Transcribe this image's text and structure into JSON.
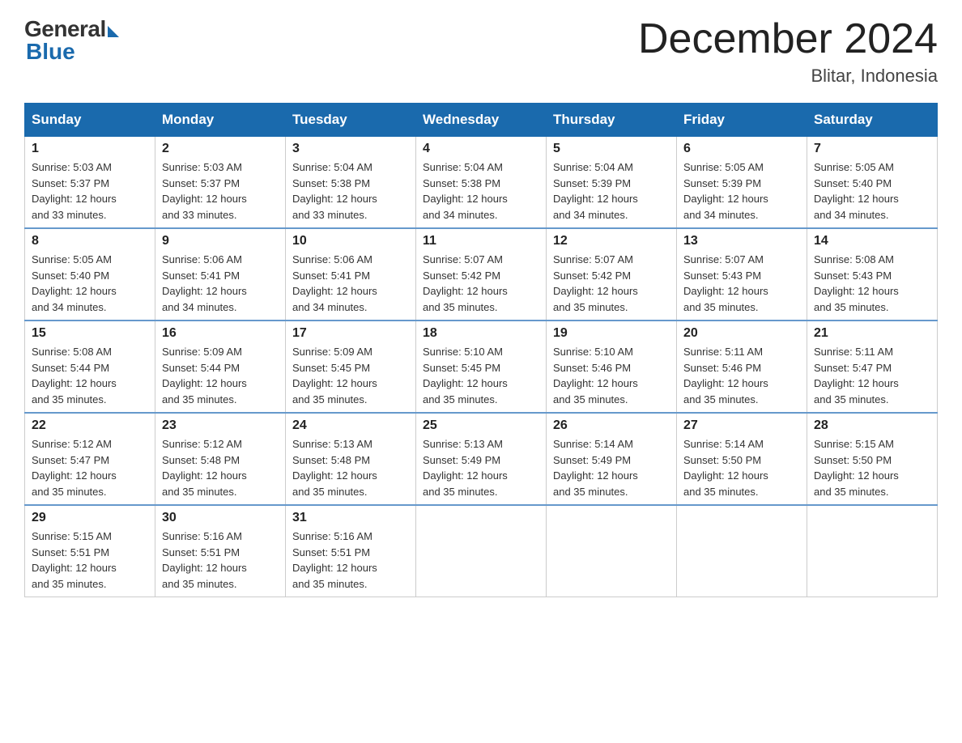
{
  "header": {
    "logo_general": "General",
    "logo_blue": "Blue",
    "title": "December 2024",
    "location": "Blitar, Indonesia"
  },
  "days_of_week": [
    "Sunday",
    "Monday",
    "Tuesday",
    "Wednesday",
    "Thursday",
    "Friday",
    "Saturday"
  ],
  "weeks": [
    [
      {
        "day": "1",
        "sunrise": "5:03 AM",
        "sunset": "5:37 PM",
        "daylight": "12 hours and 33 minutes."
      },
      {
        "day": "2",
        "sunrise": "5:03 AM",
        "sunset": "5:37 PM",
        "daylight": "12 hours and 33 minutes."
      },
      {
        "day": "3",
        "sunrise": "5:04 AM",
        "sunset": "5:38 PM",
        "daylight": "12 hours and 33 minutes."
      },
      {
        "day": "4",
        "sunrise": "5:04 AM",
        "sunset": "5:38 PM",
        "daylight": "12 hours and 34 minutes."
      },
      {
        "day": "5",
        "sunrise": "5:04 AM",
        "sunset": "5:39 PM",
        "daylight": "12 hours and 34 minutes."
      },
      {
        "day": "6",
        "sunrise": "5:05 AM",
        "sunset": "5:39 PM",
        "daylight": "12 hours and 34 minutes."
      },
      {
        "day": "7",
        "sunrise": "5:05 AM",
        "sunset": "5:40 PM",
        "daylight": "12 hours and 34 minutes."
      }
    ],
    [
      {
        "day": "8",
        "sunrise": "5:05 AM",
        "sunset": "5:40 PM",
        "daylight": "12 hours and 34 minutes."
      },
      {
        "day": "9",
        "sunrise": "5:06 AM",
        "sunset": "5:41 PM",
        "daylight": "12 hours and 34 minutes."
      },
      {
        "day": "10",
        "sunrise": "5:06 AM",
        "sunset": "5:41 PM",
        "daylight": "12 hours and 34 minutes."
      },
      {
        "day": "11",
        "sunrise": "5:07 AM",
        "sunset": "5:42 PM",
        "daylight": "12 hours and 35 minutes."
      },
      {
        "day": "12",
        "sunrise": "5:07 AM",
        "sunset": "5:42 PM",
        "daylight": "12 hours and 35 minutes."
      },
      {
        "day": "13",
        "sunrise": "5:07 AM",
        "sunset": "5:43 PM",
        "daylight": "12 hours and 35 minutes."
      },
      {
        "day": "14",
        "sunrise": "5:08 AM",
        "sunset": "5:43 PM",
        "daylight": "12 hours and 35 minutes."
      }
    ],
    [
      {
        "day": "15",
        "sunrise": "5:08 AM",
        "sunset": "5:44 PM",
        "daylight": "12 hours and 35 minutes."
      },
      {
        "day": "16",
        "sunrise": "5:09 AM",
        "sunset": "5:44 PM",
        "daylight": "12 hours and 35 minutes."
      },
      {
        "day": "17",
        "sunrise": "5:09 AM",
        "sunset": "5:45 PM",
        "daylight": "12 hours and 35 minutes."
      },
      {
        "day": "18",
        "sunrise": "5:10 AM",
        "sunset": "5:45 PM",
        "daylight": "12 hours and 35 minutes."
      },
      {
        "day": "19",
        "sunrise": "5:10 AM",
        "sunset": "5:46 PM",
        "daylight": "12 hours and 35 minutes."
      },
      {
        "day": "20",
        "sunrise": "5:11 AM",
        "sunset": "5:46 PM",
        "daylight": "12 hours and 35 minutes."
      },
      {
        "day": "21",
        "sunrise": "5:11 AM",
        "sunset": "5:47 PM",
        "daylight": "12 hours and 35 minutes."
      }
    ],
    [
      {
        "day": "22",
        "sunrise": "5:12 AM",
        "sunset": "5:47 PM",
        "daylight": "12 hours and 35 minutes."
      },
      {
        "day": "23",
        "sunrise": "5:12 AM",
        "sunset": "5:48 PM",
        "daylight": "12 hours and 35 minutes."
      },
      {
        "day": "24",
        "sunrise": "5:13 AM",
        "sunset": "5:48 PM",
        "daylight": "12 hours and 35 minutes."
      },
      {
        "day": "25",
        "sunrise": "5:13 AM",
        "sunset": "5:49 PM",
        "daylight": "12 hours and 35 minutes."
      },
      {
        "day": "26",
        "sunrise": "5:14 AM",
        "sunset": "5:49 PM",
        "daylight": "12 hours and 35 minutes."
      },
      {
        "day": "27",
        "sunrise": "5:14 AM",
        "sunset": "5:50 PM",
        "daylight": "12 hours and 35 minutes."
      },
      {
        "day": "28",
        "sunrise": "5:15 AM",
        "sunset": "5:50 PM",
        "daylight": "12 hours and 35 minutes."
      }
    ],
    [
      {
        "day": "29",
        "sunrise": "5:15 AM",
        "sunset": "5:51 PM",
        "daylight": "12 hours and 35 minutes."
      },
      {
        "day": "30",
        "sunrise": "5:16 AM",
        "sunset": "5:51 PM",
        "daylight": "12 hours and 35 minutes."
      },
      {
        "day": "31",
        "sunrise": "5:16 AM",
        "sunset": "5:51 PM",
        "daylight": "12 hours and 35 minutes."
      },
      null,
      null,
      null,
      null
    ]
  ],
  "labels": {
    "sunrise": "Sunrise:",
    "sunset": "Sunset:",
    "daylight": "Daylight:"
  }
}
